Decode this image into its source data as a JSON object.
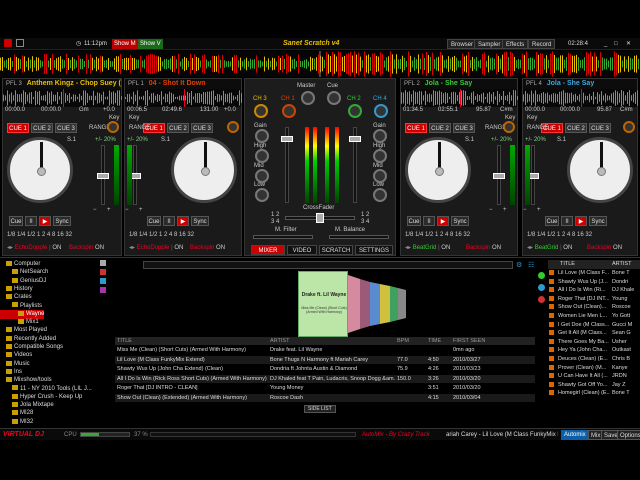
{
  "topbar": {
    "time": "11:12pm",
    "show_m": "Show M",
    "show_v": "Show V",
    "logo": "Sanet Scratch v4",
    "buttons": [
      "Browser",
      "Sampler",
      "Effects",
      "Record"
    ],
    "clock": "02:28:4"
  },
  "decks": [
    {
      "pfl": "PFL 3",
      "title": "Anthem Kingz - Chop Suey (E",
      "elapsed": "00:00.0",
      "remain": "00:00.0",
      "bpm": "Gm",
      "pitch": "+0.0",
      "key": "Key",
      "range": "RANGE",
      "fx": "EchoDopple",
      "sampler": "Backspin",
      "color": "#e8c000"
    },
    {
      "pfl": "PFL 1",
      "title": "04 - Shot It Down",
      "elapsed": "00:06.5",
      "remain": "02:49.6",
      "bpm": "131.00",
      "pitch": "+0.0",
      "key": "Key",
      "range": "RANGE",
      "fx": "EchoDopple",
      "sampler": "Backspin",
      "color": "#e04000"
    },
    {
      "pfl": "PFL 2",
      "title": "Jola - She Say",
      "elapsed": "01:34.5",
      "remain": "02:55.1",
      "bpm": "95.87",
      "pitch": "C#m",
      "key": "Key",
      "range": "RANGE",
      "fx": "BeatGrid",
      "sampler": "Backspin",
      "color": "#3c3"
    },
    {
      "pfl": "PFL 4",
      "title": "Jola - She Say",
      "elapsed": "00:00.0",
      "remain": "00:00.0",
      "bpm": "95.87",
      "pitch": "C#m",
      "key": "Key",
      "range": "RANGE",
      "fx": "BeatGrid",
      "sampler": "Backspin",
      "color": "#3aa8e0"
    }
  ],
  "deck_labels": {
    "cue1": "CUE 1",
    "cue2": "CUE 2",
    "cue3": "CUE 3",
    "cue": "Cue",
    "pause": "II",
    "play": "▶",
    "sync": "Sync",
    "loops": "1/8 1/4 1/2  1  2  4  8  16  32",
    "on": "ON",
    "s1": "S.1",
    "pm": "+/- 20%"
  },
  "mixer": {
    "master": "Master",
    "cue": "Cue",
    "ch": [
      "CH 3",
      "CH 1",
      "CH 2",
      "CH 4"
    ],
    "gain": "Gain",
    "high": "High",
    "mid": "Mid",
    "low": "Low",
    "crossfader": "CrossFader",
    "mfilter": "M. Filter",
    "mbalance": "M. Balance",
    "cf_left": "1 2\n3 4",
    "tabs": [
      "MIXER",
      "VIDEO",
      "SCRATCH",
      "SETTINGS"
    ]
  },
  "tree": [
    {
      "label": "Computer",
      "indent": 1,
      "sel": false
    },
    {
      "label": "NetSearch",
      "indent": 2,
      "sel": false
    },
    {
      "label": "GeniusDJ",
      "indent": 2,
      "sel": false
    },
    {
      "label": "History",
      "indent": 1,
      "sel": false
    },
    {
      "label": "Crates",
      "indent": 1,
      "sel": false
    },
    {
      "label": "Playlists",
      "indent": 2,
      "sel": false
    },
    {
      "label": "Wayne",
      "indent": 3,
      "sel": true
    },
    {
      "label": "Mix1",
      "indent": 3,
      "sel": false
    },
    {
      "label": "Most Played",
      "indent": 1,
      "sel": false
    },
    {
      "label": "Recently Added",
      "indent": 1,
      "sel": false
    },
    {
      "label": "Compatible Songs",
      "indent": 1,
      "sel": false
    },
    {
      "label": "Videos",
      "indent": 1,
      "sel": false
    },
    {
      "label": "Music",
      "indent": 1,
      "sel": false
    },
    {
      "label": "Ins",
      "indent": 1,
      "sel": false
    },
    {
      "label": "Mixshow/tools",
      "indent": 1,
      "sel": false
    },
    {
      "label": "11 - NY 2010 Tools (LIL J...",
      "indent": 2,
      "sel": false
    },
    {
      "label": "Hyper Crush - Keep Up",
      "indent": 2,
      "sel": false
    },
    {
      "label": "Jola Mixtape",
      "indent": 2,
      "sel": false
    },
    {
      "label": "MI28",
      "indent": 2,
      "sel": false
    },
    {
      "label": "MI32",
      "indent": 2,
      "sel": false
    }
  ],
  "cover": {
    "artist": "Drake ft. Lil Wayne",
    "title": "Miss Me (Clean) (Short Cuts) (Armed With Harmony)"
  },
  "filelist": {
    "headers": [
      "TITLE",
      "ARTIST",
      "BPM",
      "TIME",
      "FIRST SEEN"
    ],
    "rows": [
      {
        "title": "Miss Me (Clean) (Short Cuts) (Armed With Harmony)",
        "artist": "Drake feat. Lil Wayne",
        "bpm": "",
        "time": "",
        "seen": "0mn ago"
      },
      {
        "title": "Lil Love (M Class FunkyMix Extend)",
        "artist": "Bone Thugs N Harmony ft Mariah Carey",
        "bpm": "77.0",
        "time": "4:50",
        "seen": "2010/03/27"
      },
      {
        "title": "Shawty Wus Up (John Cha Extend) (Clean)",
        "artist": "Dondria ft Johnta Austin & Diamond",
        "bpm": "75.9",
        "time": "4:26",
        "seen": "2010/03/23"
      },
      {
        "title": "All I Do Is Win (Rick Ross Short Cuts) (Armed With Harmony)",
        "artist": "DJ Khaled feat T Pain, Ludacris, Snoop Dogg &am...",
        "bpm": "150.0",
        "time": "3:26",
        "seen": "2010/03/20"
      },
      {
        "title": "Roger That [DJ INTRO - CLEAN]",
        "artist": "Young Money",
        "bpm": "",
        "time": "3:51",
        "seen": "2010/03/20"
      },
      {
        "title": "Show Out (Clean) (Extended) (Armed With Harmony)",
        "artist": "Roscoe Dash",
        "bpm": "",
        "time": "4:15",
        "seen": "2010/03/04"
      }
    ],
    "sidelist_btn": "SIDE LIST"
  },
  "sidelist": {
    "headers": [
      "TITLE",
      "ARTIST"
    ],
    "rows": [
      {
        "title": "Lil Love (M Class F...",
        "artist": "Bone T"
      },
      {
        "title": "Shawty Wus Up (J...",
        "artist": "Dondri"
      },
      {
        "title": "All I Do Is Win (Ri...",
        "artist": "DJ Khale"
      },
      {
        "title": "Roger That [DJ INT...",
        "artist": "Young"
      },
      {
        "title": "Show Out (Clean)...",
        "artist": "Roscoe"
      },
      {
        "title": "Women Lie Men L...",
        "artist": "Yo Gott"
      },
      {
        "title": "I Get Doe (M Class...",
        "artist": "Gucci M"
      },
      {
        "title": "Get It All (M Class...",
        "artist": "Sean G"
      },
      {
        "title": "There Goes My Ba...",
        "artist": "Usher"
      },
      {
        "title": "Hey Ya (John Cha...",
        "artist": "Outkast"
      },
      {
        "title": "Deuces (Clean) (E...",
        "artist": "Chris B"
      },
      {
        "title": "Prover (Clean) (M...",
        "artist": "Kanye"
      },
      {
        "title": "U Can Have It All (...",
        "artist": "JRDN"
      },
      {
        "title": "Shawty Got Off Yo...",
        "artist": "Jay Z"
      },
      {
        "title": "Homegirl (Clean) (E...",
        "artist": "Bone T"
      }
    ]
  },
  "bottombar": {
    "brand": "VIRTUAL DJ",
    "cpu": "CPU",
    "pct": "37 %",
    "scroll_a": "AutoMix - By Crazy Track",
    "scroll_b": "ariah Carey - Lil Love (M Class FunkyMix Ex",
    "buttons": [
      "Automix",
      "Mix",
      "Save",
      "Options"
    ]
  }
}
